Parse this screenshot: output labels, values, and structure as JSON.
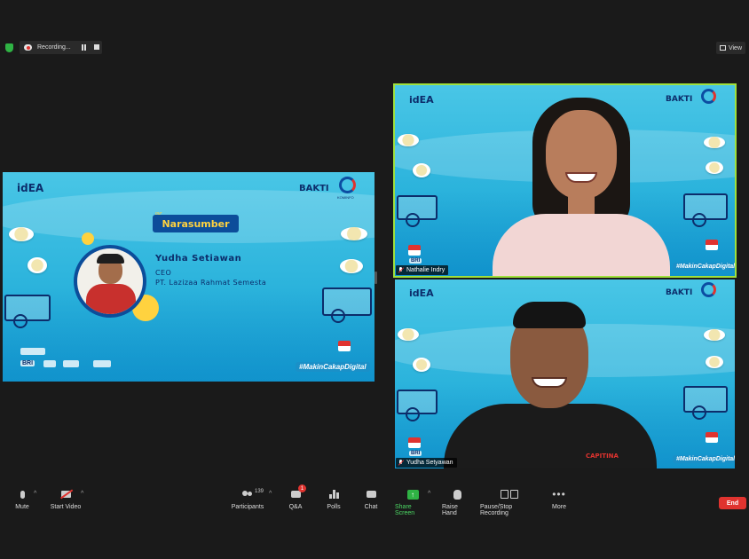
{
  "topbar": {
    "recording_label": "Recording...",
    "view_label": "View"
  },
  "shared_screen": {
    "logo_idea": "idEA",
    "logo_bakti": "BAKTI",
    "logo_kominfo": "KOMINFO",
    "section_title": "Narasumber",
    "speaker_name": "Yudha Setiawan",
    "speaker_role": "CEO",
    "speaker_org": "PT. Lazizaa Rahmat Semesta",
    "hashtag": "#MakinCakapDigital",
    "sponsor_bri": "BRI"
  },
  "participants": [
    {
      "name": "Nathalie Indry",
      "muted": true,
      "logo_idea": "idEA",
      "logo_bakti": "BAKTI",
      "hashtag": "#MakinCakapDigital",
      "sponsor_bri": "BRI"
    },
    {
      "name": "Yudha Setyawan",
      "muted": true,
      "logo_idea": "idEA",
      "logo_bakti": "BAKTI",
      "hashtag": "#MakinCakapDigital",
      "sponsor_bri": "BRI",
      "shirt_text": "CAPITINA"
    }
  ],
  "toolbar": {
    "mute": "Mute",
    "start_video": "Start Video",
    "participants": "Participants",
    "participants_count": "139",
    "qa": "Q&A",
    "qa_badge": "1",
    "polls": "Polls",
    "chat": "Chat",
    "share_screen": "Share Screen",
    "raise_hand": "Raise Hand",
    "pause_stop_recording": "Pause/Stop Recording",
    "more": "More",
    "end": "End"
  },
  "colors": {
    "accent_green": "#2fb344",
    "end_red": "#e0332f",
    "active_speaker_border": "#9fe03d",
    "slide_navy": "#0c2d6b",
    "slide_yellow": "#ffd23f"
  },
  "icons": {
    "mute": "microphone-icon",
    "video": "video-off-icon",
    "participants": "people-icon",
    "qa": "qa-icon",
    "polls": "bar-chart-icon",
    "chat": "chat-bubble-icon",
    "share": "share-screen-icon",
    "raise_hand": "hand-icon",
    "recording": "pause-stop-icon",
    "more": "more-dots-icon"
  }
}
